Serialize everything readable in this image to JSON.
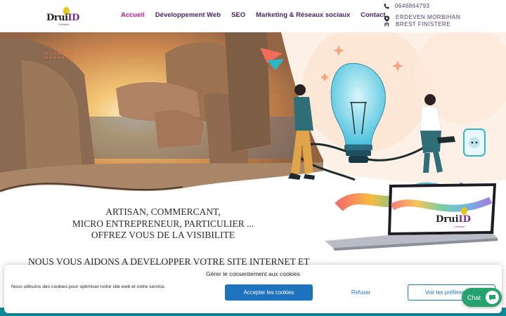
{
  "header": {
    "logo": {
      "word_a": "Drui",
      "word_b": "ID",
      "sub": "Création"
    },
    "nav": [
      {
        "label": "Accueil",
        "active": true
      },
      {
        "label": "Développement Web",
        "active": false
      },
      {
        "label": "SEO",
        "active": false
      },
      {
        "label": "Marketing & Réseaux sociaux",
        "active": false
      },
      {
        "label": "Contact",
        "active": false
      }
    ],
    "phone": "0646864793",
    "location_line1": "ERDEVEN MORBIHAN",
    "location_line2": "BREST FINISTERE",
    "phone_icon": "phone-icon",
    "location_icon": "map-pin-icon"
  },
  "main": {
    "tagline_line1": "ARTISAN, COMMERCANT,",
    "tagline_line2": "MICRO ENTREPRENEUR, PARTICULIER ...",
    "tagline_line3": "OFFREZ VOUS DE LA VISIBILITE",
    "aide": "NOUS VOUS AIDONS A DEVELOPPER VOTRE SITE INTERNET ET",
    "laptop_logo": {
      "word_a": "Drui",
      "word_b": "ID",
      "sub": "Création"
    }
  },
  "cookie": {
    "title": "Gérer le consentement aux cookies",
    "message": "Nous utilisons des cookies pour optimiser notre site web et notre service.",
    "accept": "Accepter les cookies",
    "refuse": "Refuser",
    "prefs": "Voir les préférences"
  },
  "chat": {
    "label": "Chat",
    "icon": "chat-bubble-icon"
  },
  "colors": {
    "nav_active": "#b51c8f",
    "nav_text": "#4b2360",
    "accent_blue": "#1e73be",
    "chat_green": "#25a26e",
    "band_teal": "#0f8a9d"
  }
}
